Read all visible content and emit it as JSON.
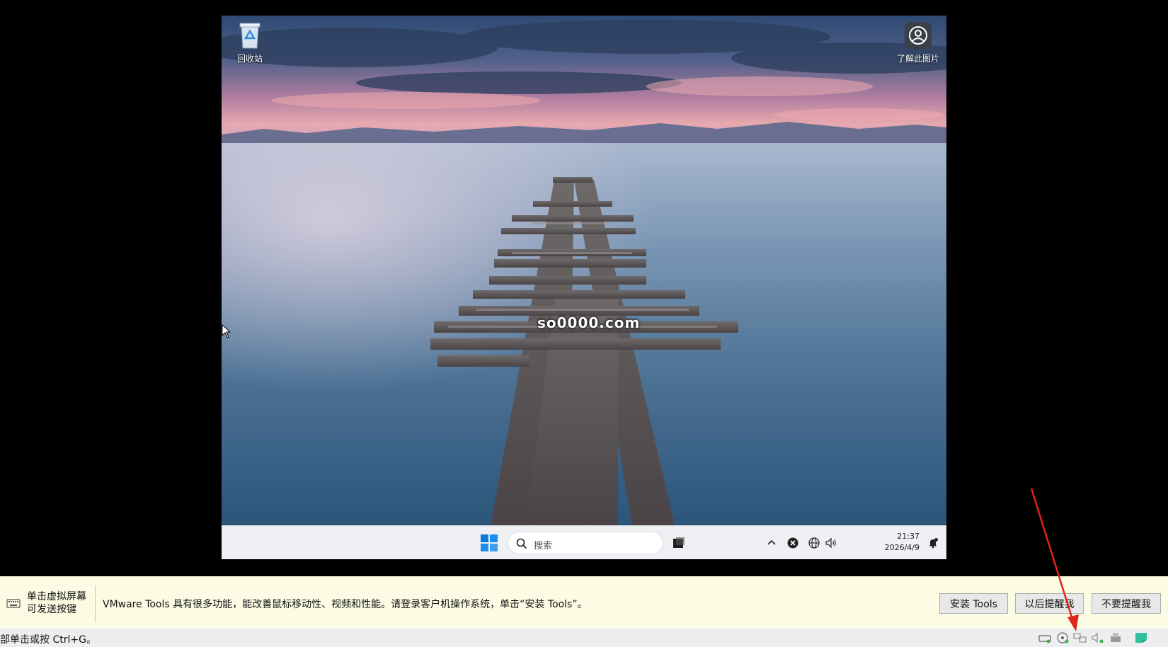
{
  "desktop": {
    "icons": [
      {
        "label": "回收站",
        "icon": "recycle-bin-icon"
      },
      {
        "label": "了解此图片",
        "icon": "learn-image-icon"
      }
    ],
    "watermark": "so0000.com"
  },
  "taskbar": {
    "search_placeholder": "搜索",
    "clock_time": "21:37",
    "clock_date": "2026/4/9",
    "tray_icons": [
      "chevron-up-icon",
      "close-circle-icon",
      "globe-icon",
      "speaker-icon",
      "notification-bell-icon"
    ]
  },
  "notification": {
    "hint": "单击虚拟屏幕\n可发送按键",
    "hint_line1": "单击虚拟屏幕",
    "hint_line2": "可发送按键",
    "message": "VMware Tools 具有很多功能，能改善鼠标移动性、视频和性能。请登录客户机操作系统，单击“安装 Tools”。",
    "buttons": [
      "安装 Tools",
      "以后提醒我",
      "不要提醒我"
    ]
  },
  "statusbar": {
    "text": "部单击或按 Ctrl+G。",
    "icons": [
      "hard-disk-icon",
      "cd-drive-icon",
      "network-icon",
      "sound-icon",
      "printer-icon",
      "message-log-icon"
    ]
  },
  "colors": {
    "notification_bg": "#fcfce5",
    "taskbar_bg": "#eef0f4",
    "annotation_arrow": "#e0231b",
    "windows_blue": "#0a7ae0"
  }
}
